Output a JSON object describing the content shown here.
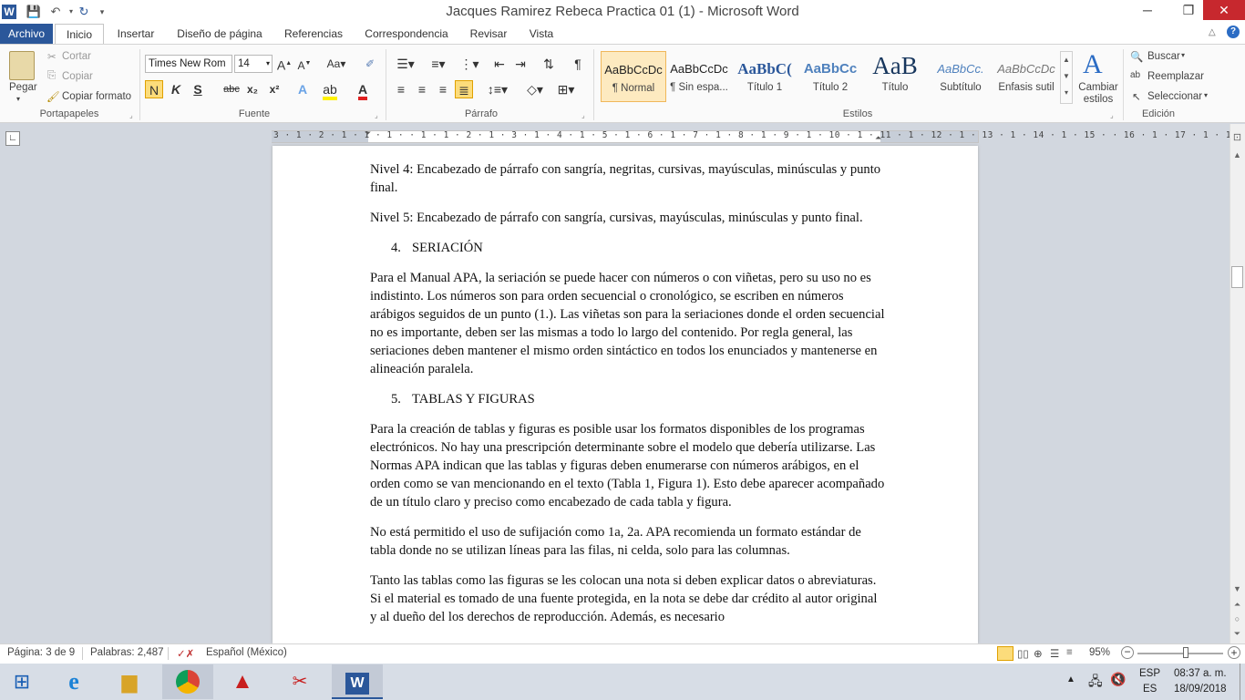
{
  "titlebar": {
    "title": "Jacques Ramirez Rebeca Practica 01 (1)  -  Microsoft Word",
    "word_icon": "W",
    "minimize": "─",
    "restore": "❐",
    "close": "✕"
  },
  "tabs": [
    "Archivo",
    "Inicio",
    "Insertar",
    "Diseño de página",
    "Referencias",
    "Correspondencia",
    "Revisar",
    "Vista"
  ],
  "clipboard": {
    "paste": "Pegar",
    "cut": "Cortar",
    "copy": "Copiar",
    "format_painter": "Copiar formato",
    "label": "Portapapeles"
  },
  "font": {
    "name": "Times New Rom",
    "size": "14",
    "label": "Fuente",
    "bold": "N",
    "italic": "K",
    "underline": "S",
    "strike": "abc",
    "sub": "x₂",
    "sup": "x²"
  },
  "paragraph": {
    "label": "Párrafo"
  },
  "styles": {
    "label": "Estilos",
    "items": [
      {
        "sample": "AaBbCcDc",
        "name": "¶ Normal"
      },
      {
        "sample": "AaBbCcDc",
        "name": "¶ Sin espa..."
      },
      {
        "sample": "AaBbC(",
        "name": "Título 1"
      },
      {
        "sample": "AaBbCc",
        "name": "Título 2"
      },
      {
        "sample": "AaB",
        "name": "Título"
      },
      {
        "sample": "AaBbCc.",
        "name": "Subtítulo"
      },
      {
        "sample": "AaBbCcDc",
        "name": "Énfasis sutil"
      }
    ],
    "change_styles": "Cambiar estilos"
  },
  "editing": {
    "label": "Edición",
    "find": "Buscar",
    "replace": "Reemplazar",
    "select": "Seleccionar"
  },
  "ruler": {
    "text": "3 · 1 · 2 · 1 · 1 · 1 ·   · 1 · 1 · 2 · 1 · 3 · 1 · 4 · 1 · 5 · 1 · 6 · 1 · 7 · 1 · 8 · 1 · 9 · 1 · 10 · 1 · 11 · 1 · 12 · 1 · 13 · 1 · 14 · 1 · 15 ·  · 16 · 1 · 17 · 1 · 18 · 1"
  },
  "document": {
    "p1": "Nivel 4: Encabezado de párrafo con sangría, negritas, cursivas, mayúsculas, minúsculas y punto final.",
    "p2": "Nivel 5: Encabezado de párrafo con sangría, cursivas, mayúsculas, minúsculas y punto final.",
    "h4_num": "4.",
    "h4": "SERIACIÓN",
    "p3": "Para el Manual APA, la seriación se puede hacer con números o con viñetas, pero su uso no es indistinto. Los números son para orden secuencial o cronológico, se escriben en números arábigos seguidos de un punto (1.). Las viñetas son para la seriaciones donde el orden secuencial no es importante, deben ser las mismas a todo lo largo del contenido. Por regla general, las seriaciones deben mantener el mismo orden sintáctico en todos los enunciados y mantenerse en alineación paralela.",
    "h5_num": "5.",
    "h5": "TABLAS Y FIGURAS",
    "p4": "Para la creación de tablas y figuras es posible usar los formatos disponibles de los programas electrónicos. No hay una prescripción determinante sobre el modelo que debería utilizarse. Las Normas APA indican que las tablas y figuras deben enumerarse con números arábigos, en el orden como se van mencionando en el texto (Tabla 1, Figura 1). Esto debe aparecer acompañado de un título claro y preciso como encabezado de cada tabla y figura.",
    "p5": "No está permitido el uso de sufijación como 1a, 2a. APA recomienda un formato estándar de tabla donde no se utilizan líneas para las filas, ni celda, solo para las columnas.",
    "p6": "Tanto las tablas como las figuras se les colocan una nota si deben explicar datos o abreviaturas. Si el material es tomado de una fuente protegida, en la nota se debe dar crédito al autor original y al dueño del los derechos de reproducción. Además, es necesario"
  },
  "status": {
    "page": "Página: 3 de 9",
    "words": "Palabras: 2,487",
    "language": "Español (México)",
    "zoom": "95%",
    "zoom_level": 0.56
  },
  "taskbar": {
    "lang1": "ESP",
    "lang2": "ES",
    "time": "08:37 a. m.",
    "date": "18/09/2018"
  }
}
